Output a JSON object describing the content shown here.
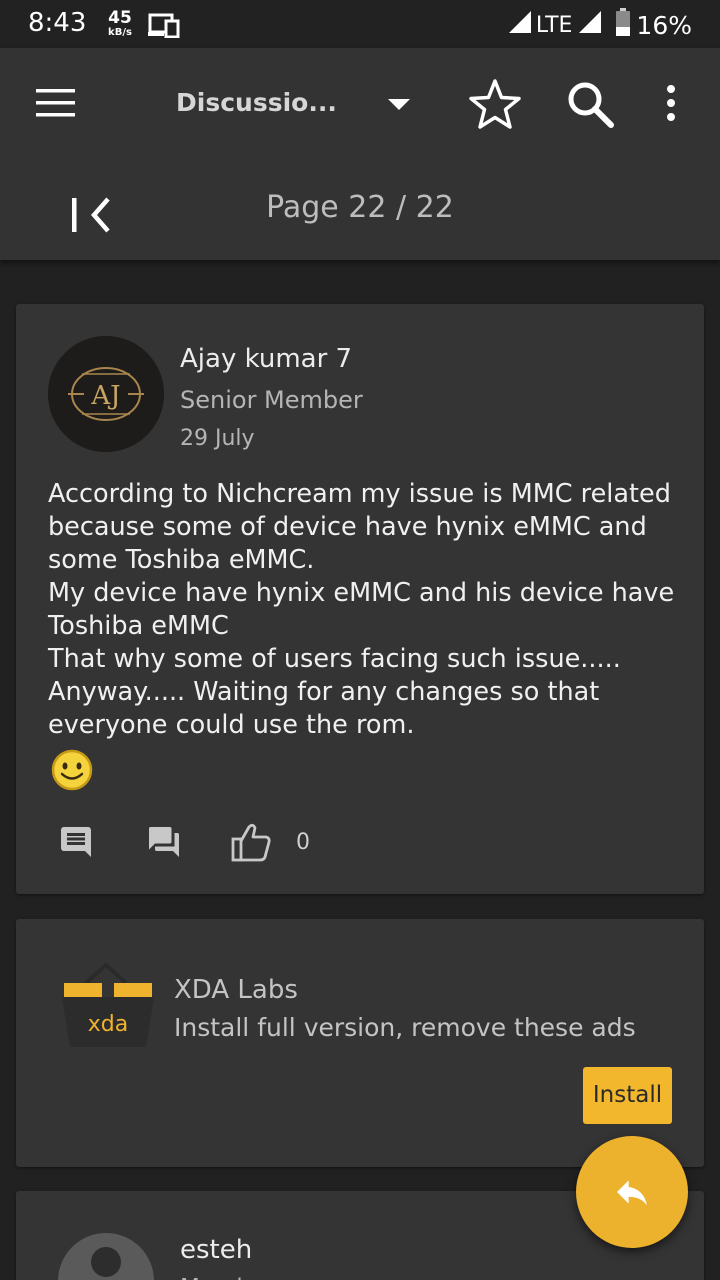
{
  "status_bar": {
    "time": "8:43",
    "net_speed_value": "45",
    "net_speed_unit": "kB/s",
    "network": "LTE",
    "battery": "16%"
  },
  "app_bar": {
    "title": "Discussio...",
    "page_label": "Page 22 / 22"
  },
  "post": {
    "author": "Ajay kumar 7",
    "role": "Senior Member",
    "date": "29 July",
    "avatar_text": "AJ",
    "body_lines": [
      "According to Nichcream my issue is MMC related",
      "because some of device have hynix eMMC and",
      "some Toshiba eMMC.",
      "My device have hynix eMMC and his device have",
      "Toshiba eMMC",
      "That why some of users facing such issue.....",
      "Anyway..... Waiting for any changes so that",
      "everyone could use the rom."
    ],
    "like_count": "0"
  },
  "ad": {
    "logo_text": "xda",
    "title": "XDA Labs",
    "subtitle": "Install full version, remove these ads",
    "button": "Install"
  },
  "next_post": {
    "author": "esteh",
    "role": "Member"
  },
  "icons": {
    "menu": "hamburger-menu-icon",
    "dropdown": "caret-down-icon",
    "star": "star-outline-icon",
    "search": "search-icon",
    "more": "more-vertical-icon",
    "first_page": "first-page-icon",
    "quote": "comment-icon",
    "reply": "forum-icon",
    "like": "thumbs-up-icon",
    "fab": "reply-icon"
  },
  "colors": {
    "accent": "#ecb22e",
    "card": "#343434",
    "background": "#212121",
    "toolbar": "#333333"
  }
}
